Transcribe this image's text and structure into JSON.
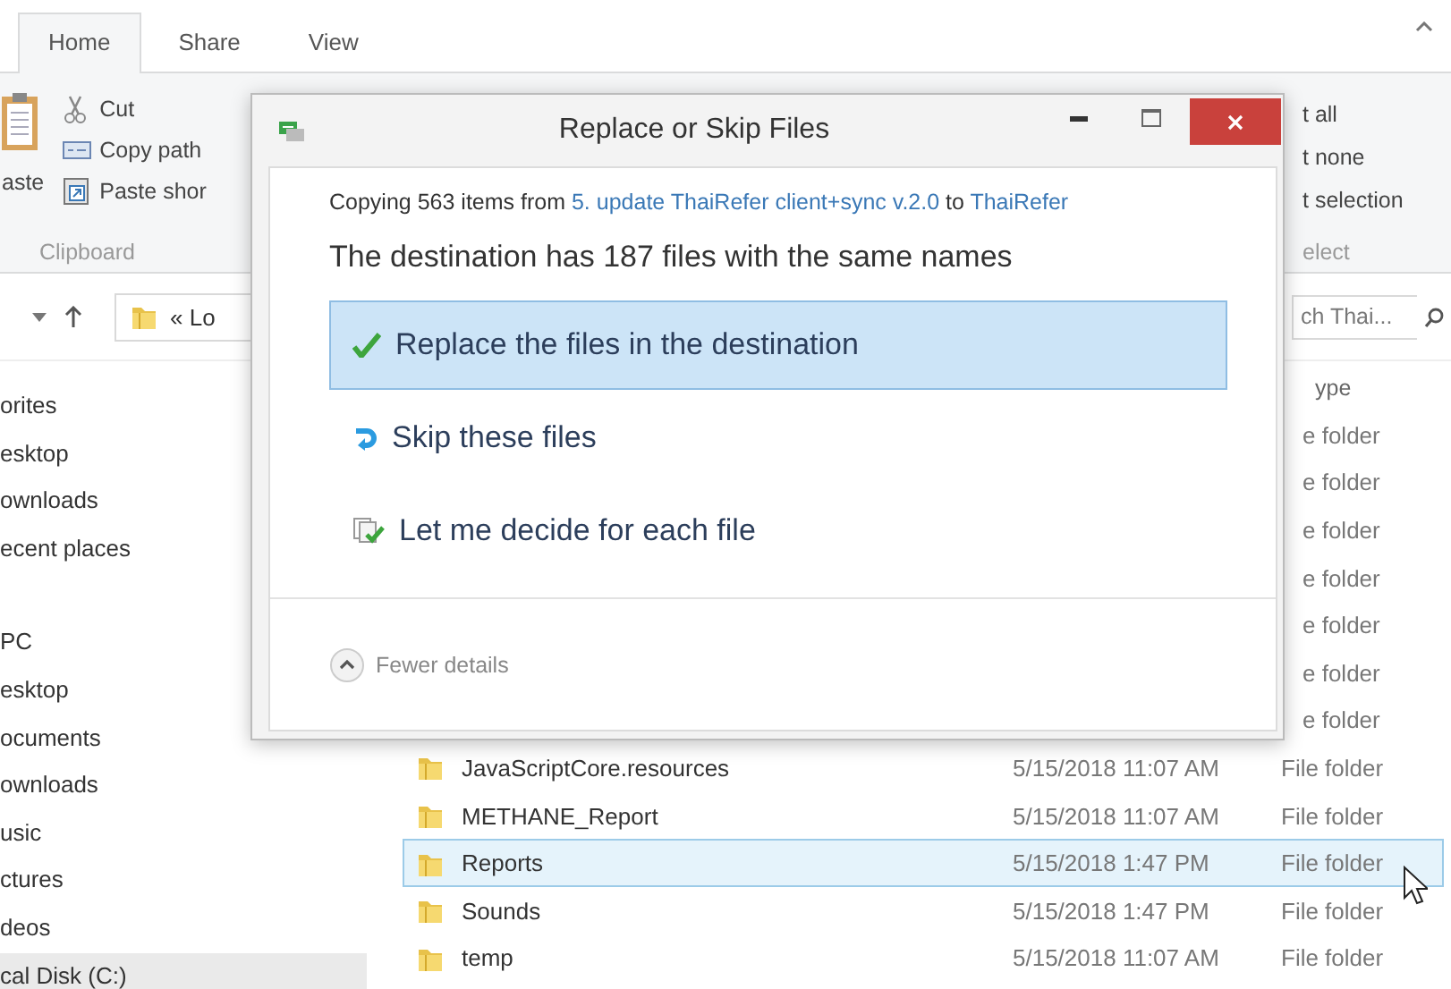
{
  "ribbon": {
    "tabs": [
      {
        "label": "Home",
        "selected": true
      },
      {
        "label": "Share",
        "selected": false
      },
      {
        "label": "View",
        "selected": false
      }
    ],
    "clipboard": {
      "paste": "aste",
      "commands": [
        "Cut",
        "Copy path",
        "Paste shor"
      ],
      "label": "Clipboard"
    },
    "select": {
      "commands": [
        "t all",
        "t none",
        "t selection"
      ],
      "label": "elect"
    }
  },
  "address_bar": {
    "path": "« Lo",
    "search_placeholder": "ch Thai..."
  },
  "navigation": {
    "items": [
      {
        "label": "orites",
        "selected": false,
        "children": [
          {
            "label": "esktop",
            "selected": false
          },
          {
            "label": "ownloads",
            "selected": false
          },
          {
            "label": "ecent places",
            "selected": false
          }
        ]
      },
      {
        "label": "PC",
        "selected": false,
        "children": [
          {
            "label": "esktop",
            "selected": false
          },
          {
            "label": "ocuments",
            "selected": false
          },
          {
            "label": "ownloads",
            "selected": false
          },
          {
            "label": "usic",
            "selected": false
          },
          {
            "label": "ctures",
            "selected": false
          },
          {
            "label": "deos",
            "selected": false
          },
          {
            "label": "cal Disk (C:)",
            "selected": true
          }
        ]
      }
    ]
  },
  "file_list": {
    "column_header": "ype",
    "rows": [
      {
        "type": "e folder",
        "selected": false
      },
      {
        "type": "e folder",
        "selected": false
      },
      {
        "type": "e folder",
        "selected": false
      },
      {
        "type": "e folder",
        "selected": false
      },
      {
        "type": "e folder",
        "selected": false
      },
      {
        "type": "e folder",
        "selected": false
      },
      {
        "type": "e folder",
        "selected": false
      },
      {
        "name": "JavaScriptCore.resources",
        "date": "5/15/2018 11:07 AM",
        "type": "File folder",
        "selected": false
      },
      {
        "name": "METHANE_Report",
        "date": "5/15/2018 11:07 AM",
        "type": "File folder",
        "selected": false
      },
      {
        "name": "Reports",
        "date": "5/15/2018 1:47 PM",
        "type": "File folder",
        "selected": true
      },
      {
        "name": "Sounds",
        "date": "5/15/2018 1:47 PM",
        "type": "File folder",
        "selected": false
      },
      {
        "name": "temp",
        "date": "5/15/2018 11:07 AM",
        "type": "File folder",
        "selected": false
      }
    ]
  },
  "dialog": {
    "title": "Replace or Skip Files",
    "copying": {
      "prefix": "Copying 563 items from",
      "source": "5. update ThaiRefer client+sync v.2.0",
      "joiner": "to",
      "destination": "ThaiRefer"
    },
    "heading": "The destination has 187 files with the same names",
    "options": [
      {
        "label": "Replace the files in the destination",
        "kind": "replace",
        "selected": true
      },
      {
        "label": "Skip these files",
        "kind": "skip",
        "selected": false
      },
      {
        "label": "Let me decide for each file",
        "kind": "decide",
        "selected": false
      }
    ],
    "details_toggle": {
      "label": "Fewer details",
      "expanded": true
    }
  }
}
